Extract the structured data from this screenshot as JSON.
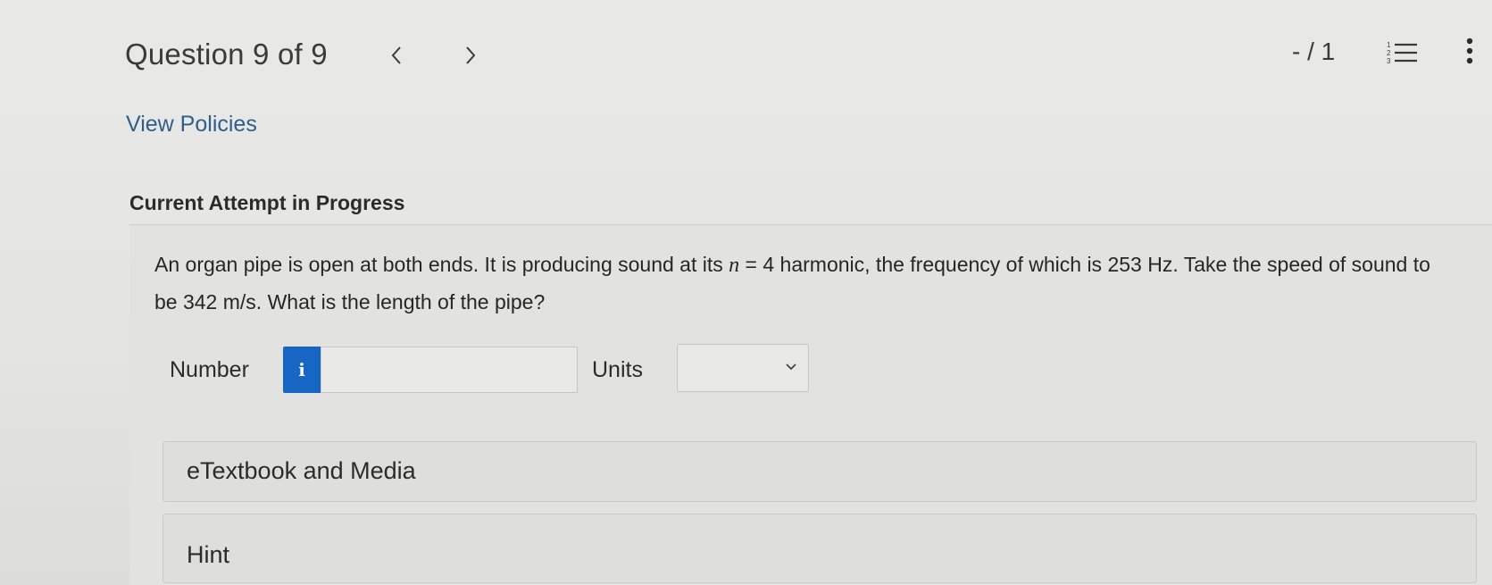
{
  "header": {
    "question_title": "Question 9 of 9",
    "prev_glyph": "‹",
    "next_glyph": "›",
    "score": "- / 1",
    "icons": [
      "chevron-left-icon",
      "chevron-right-icon",
      "numbered-list-icon",
      "more-vertical-icon"
    ]
  },
  "links": {
    "view_policies": "View Policies"
  },
  "attempt": {
    "heading": "Current Attempt in Progress",
    "question_part1": "An organ pipe is open at both ends. It is producing sound at its ",
    "question_var": "n",
    "question_part2": " = 4 harmonic, the frequency of which is 253 Hz. Take the speed of sound to be 342 m/s. What is the length of the pipe?"
  },
  "answer": {
    "number_label": "Number",
    "info_glyph": "i",
    "number_value": "",
    "units_label": "Units",
    "units_selected": ""
  },
  "panels": {
    "etextbook_label": "eTextbook and Media",
    "hint_label": "Hint"
  },
  "colors": {
    "accent_blue": "#1766c4",
    "link_blue": "#2f5e8c",
    "background": "#e6e6e4"
  }
}
